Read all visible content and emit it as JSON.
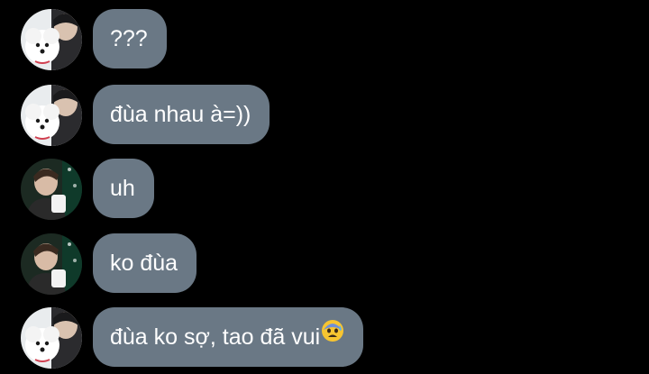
{
  "chat": {
    "messages": [
      {
        "sender": "friend-a",
        "text": "???"
      },
      {
        "sender": "friend-a",
        "text": "đùa nhau à=))"
      },
      {
        "sender": "friend-b",
        "text": "uh"
      },
      {
        "sender": "friend-b",
        "text": "ko đùa"
      },
      {
        "sender": "friend-a",
        "text": "đùa ko sợ, tao đã vui",
        "emoji": "anxious-face-with-sweat-emoji"
      }
    ]
  },
  "colors": {
    "background": "#000000",
    "bubble": "#6a7885",
    "text": "#ffffff"
  }
}
